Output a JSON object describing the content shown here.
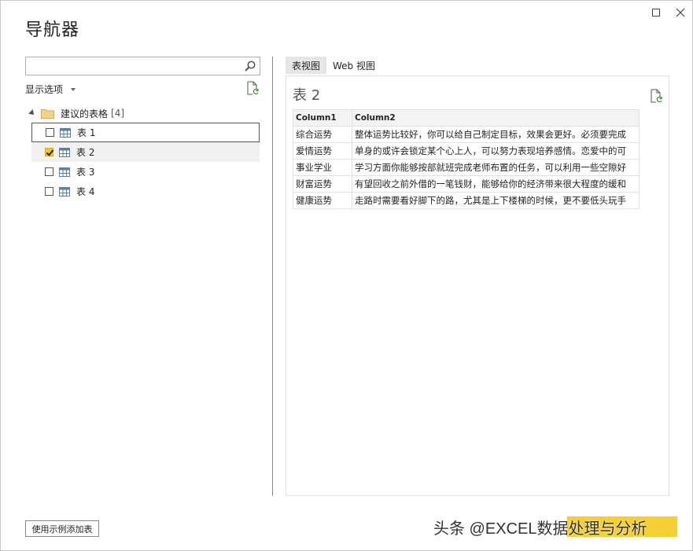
{
  "window": {
    "title": "导航器",
    "maximize_icon": "maximize-icon",
    "close_icon": "close-icon"
  },
  "left": {
    "search": {
      "value": "",
      "placeholder": ""
    },
    "display_options_label": "显示选项",
    "folder": {
      "label": "建议的表格",
      "count": "[4]"
    },
    "items": [
      {
        "label": "表 1",
        "checked": false,
        "focused": true
      },
      {
        "label": "表 2",
        "checked": true,
        "selected": true
      },
      {
        "label": "表 3",
        "checked": false
      },
      {
        "label": "表 4",
        "checked": false
      }
    ]
  },
  "right": {
    "tabs": [
      {
        "label": "表视图",
        "active": true
      },
      {
        "label": "Web 视图",
        "active": false
      }
    ],
    "preview_title": "表 2",
    "table": {
      "columns": [
        "Column1",
        "Column2"
      ],
      "rows": [
        [
          "综合运势",
          "整体运势比较好，你可以给自己制定目标，效果会更好。必须要完成"
        ],
        [
          "爱情运势",
          "单身的或许会锁定某个心上人，可以努力表现培养感情。恋爱中的可"
        ],
        [
          "事业学业",
          "学习方面你能够按部就班完成老师布置的任务，可以利用一些空隙好"
        ],
        [
          "财富运势",
          "有望回收之前外借的一笔钱财，能够给你的经济带来很大程度的缓和"
        ],
        [
          "健康运势",
          "走路时需要看好脚下的路，尤其是上下楼梯的时候，更不要低头玩手"
        ]
      ]
    }
  },
  "bottom": {
    "button_label": "使用示例添加表"
  },
  "watermark": "头条 @EXCEL数据处理与分析",
  "colors": {
    "accent": "#f2c811",
    "border": "#c8c8c8",
    "text": "#252423"
  }
}
